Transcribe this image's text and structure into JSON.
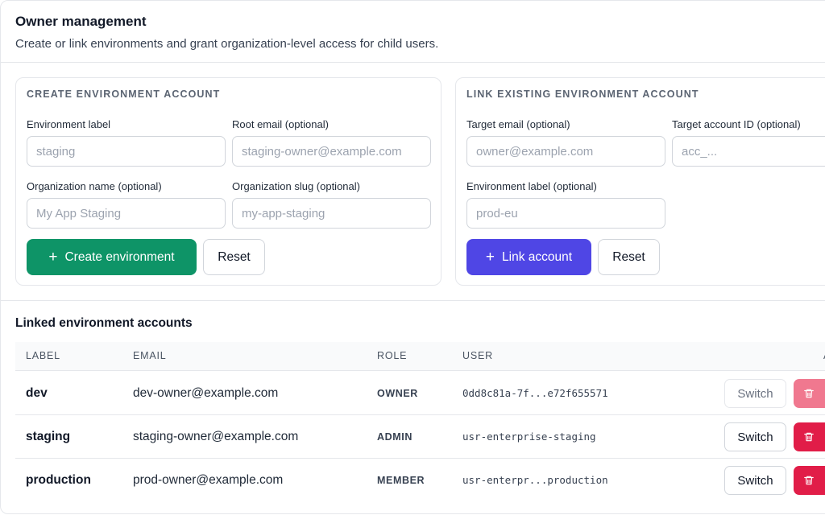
{
  "header": {
    "title": "Owner management",
    "subtitle": "Create or link environments and grant organization-level access for child users."
  },
  "create_card": {
    "title": "CREATE ENVIRONMENT ACCOUNT",
    "fields": [
      {
        "label": "Environment label",
        "placeholder": "staging",
        "value": ""
      },
      {
        "label": "Root email (optional)",
        "placeholder": "staging-owner@example.com",
        "value": ""
      },
      {
        "label": "Organization name (optional)",
        "placeholder": "My App Staging",
        "value": ""
      },
      {
        "label": "Organization slug (optional)",
        "placeholder": "my-app-staging",
        "value": ""
      }
    ],
    "primary_label": "Create environment",
    "reset_label": "Reset"
  },
  "link_card": {
    "title": "LINK EXISTING ENVIRONMENT ACCOUNT",
    "fields": [
      {
        "label": "Target email (optional)",
        "placeholder": "owner@example.com",
        "value": ""
      },
      {
        "label": "Target account ID (optional)",
        "placeholder": "acc_...",
        "value": ""
      },
      {
        "label": "Environment label (optional)",
        "placeholder": "prod-eu",
        "value": ""
      }
    ],
    "primary_label": "Link account",
    "reset_label": "Reset"
  },
  "linked": {
    "title": "Linked environment accounts",
    "columns": [
      "LABEL",
      "EMAIL",
      "ROLE",
      "USER"
    ],
    "actions_header_partial": "A",
    "switch_label": "Switch",
    "rows": [
      {
        "label": "dev",
        "email": "dev-owner@example.com",
        "role": "OWNER",
        "user": "0dd8c81a-7f...e72f655571",
        "current": true
      },
      {
        "label": "staging",
        "email": "staging-owner@example.com",
        "role": "ADMIN",
        "user": "usr-enterprise-staging",
        "current": false
      },
      {
        "label": "production",
        "email": "prod-owner@example.com",
        "role": "MEMBER",
        "user": "usr-enterpr...production",
        "current": false
      }
    ]
  },
  "colors": {
    "create_button": "#0e9467",
    "link_button": "#4f46e5",
    "delete_button": "#e11d48",
    "delete_button_disabled": "#f0788f"
  },
  "icons": {
    "plus": "plus-icon",
    "delete": "trash-icon"
  }
}
